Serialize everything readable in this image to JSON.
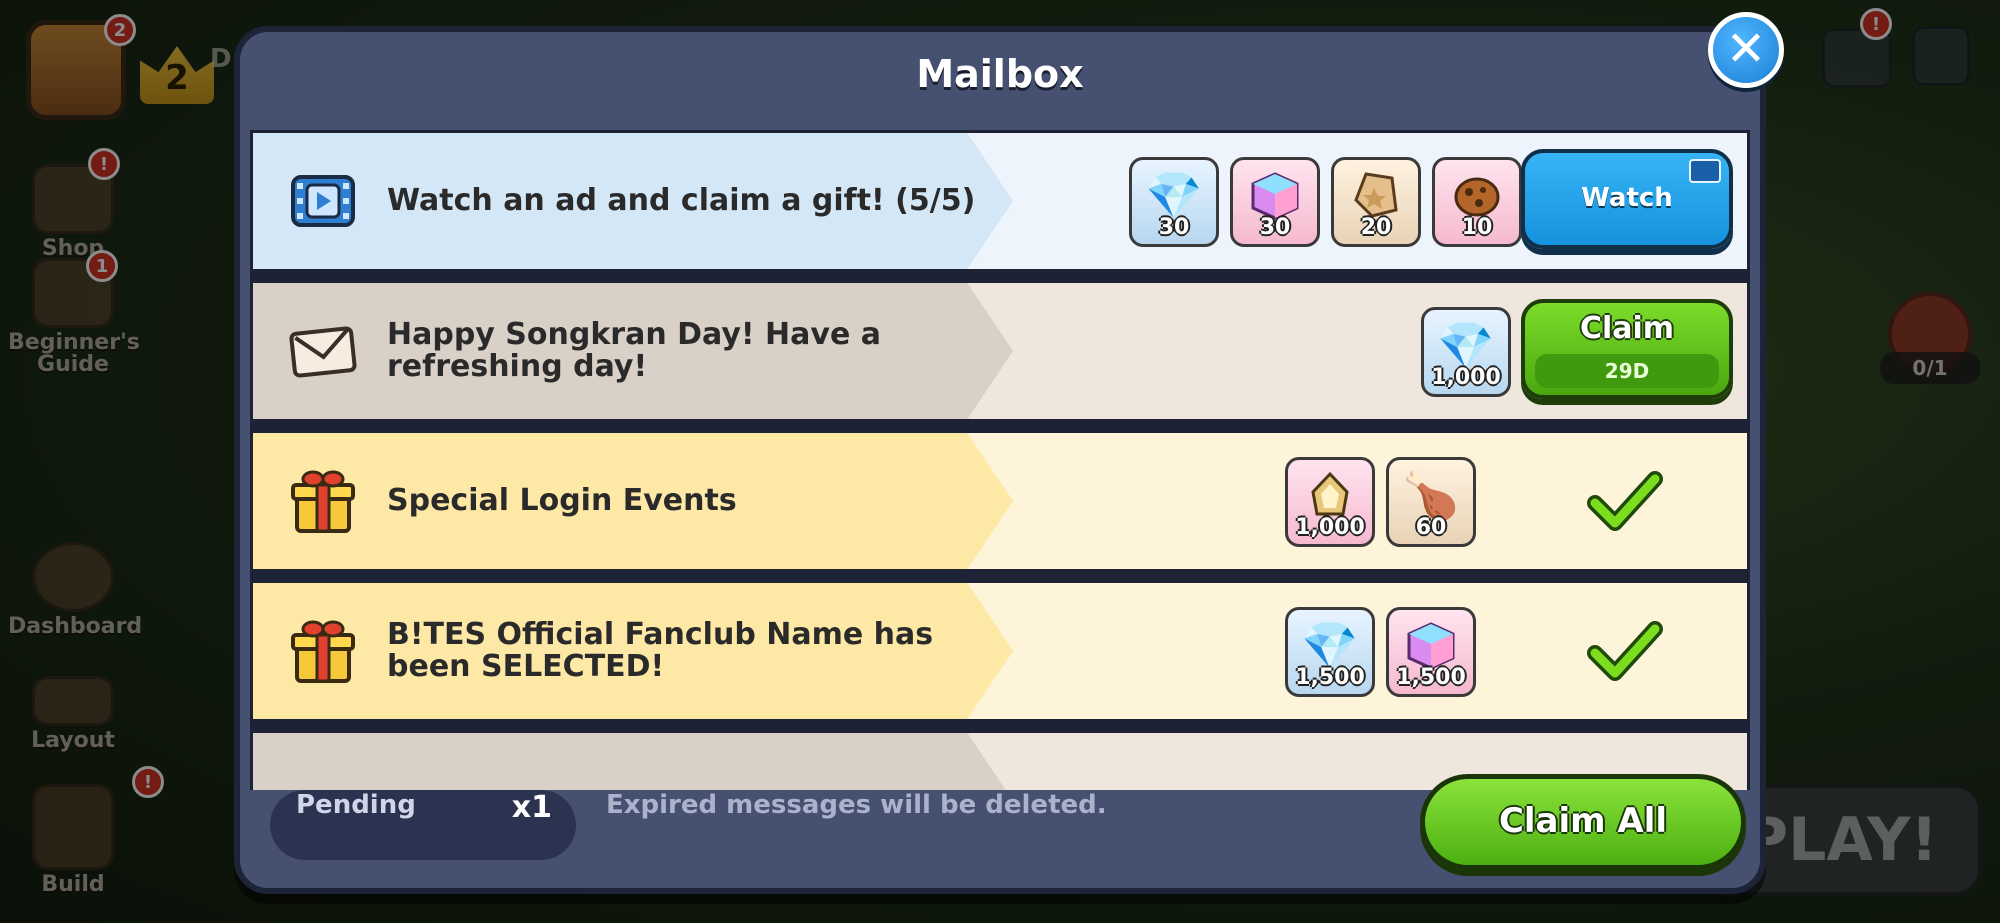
{
  "background": {
    "player_level": "2",
    "player_name_partial": "D",
    "profile_badge": "2",
    "side_menu": [
      {
        "label": "Shop",
        "badge": "!"
      },
      {
        "label": "Beginner's Guide",
        "badge": "1"
      },
      {
        "label": "Dashboard",
        "badge": ""
      },
      {
        "label": "Layout",
        "badge": ""
      },
      {
        "label": "Build",
        "badge": "!"
      }
    ],
    "mail_badge": "!",
    "quest_progress": "0/1",
    "play_label": "PLAY!"
  },
  "mailbox": {
    "title": "Mailbox",
    "close_icon": "close-icon",
    "messages": [
      {
        "type": "ad",
        "icon": "ad-film-icon",
        "title": "Watch an ad and claim a gift! (5/5)",
        "row_color": "#dbe9f5",
        "rewards": [
          {
            "icon": "crystal-icon",
            "qty": "30",
            "color": "blue"
          },
          {
            "icon": "rainbow-cube-icon",
            "qty": "30",
            "color": "pink"
          },
          {
            "icon": "soulstone-icon",
            "qty": "20",
            "color": "tan"
          },
          {
            "icon": "cookie-chunk-icon",
            "qty": "10",
            "color": "pink"
          }
        ],
        "action": {
          "kind": "watch",
          "label": "Watch"
        }
      },
      {
        "type": "letter",
        "icon": "envelope-icon",
        "title": "Happy Songkran Day! Have a refreshing day!",
        "row_color": "#eee5dc",
        "rewards": [
          {
            "icon": "crystal-icon",
            "qty": "1,000",
            "color": "blue"
          }
        ],
        "action": {
          "kind": "claim",
          "label": "Claim",
          "sub": "29D"
        }
      },
      {
        "type": "gift",
        "icon": "gift-box-icon",
        "title": "Special Login Events",
        "row_color": "#fdf3d5",
        "rewards": [
          {
            "icon": "cookie-cutter-icon",
            "qty": "1,000",
            "color": "pink"
          },
          {
            "icon": "meat-icon",
            "qty": "60",
            "color": "tan"
          }
        ],
        "action": {
          "kind": "claimed"
        }
      },
      {
        "type": "gift",
        "icon": "gift-box-icon",
        "title": "B!TES Official Fanclub Name has been SELECTED!",
        "row_color": "#fdf3d5",
        "rewards": [
          {
            "icon": "crystal-icon",
            "qty": "1,500",
            "color": "blue"
          },
          {
            "icon": "rainbow-cube-icon",
            "qty": "1,500",
            "color": "pink"
          }
        ],
        "action": {
          "kind": "claimed"
        }
      }
    ],
    "footer": {
      "pending_label": "Pending",
      "pending_count": "x1",
      "notice": "Expired messages will be deleted.",
      "claim_all_label": "Claim All"
    }
  }
}
